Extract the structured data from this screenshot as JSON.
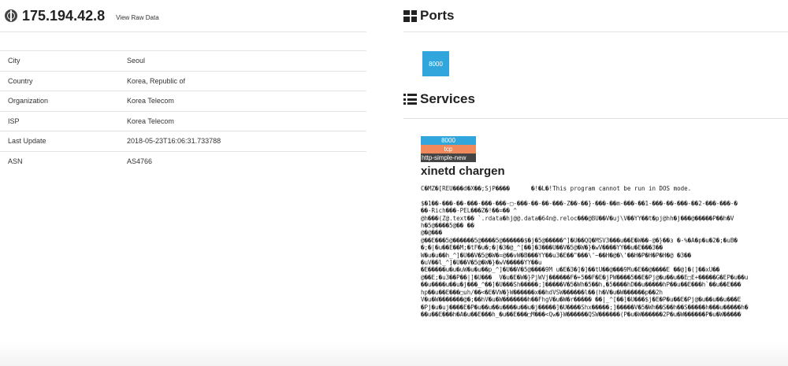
{
  "host": {
    "ip": "175.194.42.8",
    "raw_link": "View Raw Data"
  },
  "info": [
    {
      "key": "City",
      "value": "Seoul"
    },
    {
      "key": "Country",
      "value": "Korea, Republic of"
    },
    {
      "key": "Organization",
      "value": "Korea Telecom"
    },
    {
      "key": "ISP",
      "value": "Korea Telecom"
    },
    {
      "key": "Last Update",
      "value": "2018-05-23T16:06:31.733788"
    },
    {
      "key": "ASN",
      "value": "AS4766"
    }
  ],
  "ports": {
    "title": "Ports",
    "items": [
      "8000"
    ]
  },
  "services": {
    "title": "Services",
    "port": "8000",
    "protocol": "tcp",
    "module": "http-simple-new",
    "product": "xinetd chargen",
    "banner_lines": [
      "C�MZ�[REU���d�X��;SjP����      �!�L�!This program cannot be run in DOS mode.",
      "",
      "$�1��-���-��-���-���-���-□-���-��-��-���-Z��-��}-���-��m-���-��1-���-��-���-��2-���-���-�",
      "��-Rich���-PEL���Z�!��=�� ^",
      "@h���(Z@.text�� `.rdata�hj@@.data�64n@.reloc���@BU��V�uj\\V��YY��t�pj@hh�j���@�����P��h�V",
      "h�5@����5@�� ��",
      "@�@���",
      "@��E���5@������5@����5@������$�j�5@�����^]�U��QQ�MSV3���u��E�W��-@�}��з �-%�A�p�u�2�;�uB�",
      "�;�|�u��E��M;�tF�u�;�|�3�@_^[��]�3���U��V�5@�W�}�wV����YY��u�E���3��",
      "W�u�u��h_^]�U��V�5@�W�=@��vW�B���YY��u3�E��\"���\\'~��H�@�\\'��H�P�H�P�H�@ �3��",
      "�uV��l_^]�U��V�5@�W�}�wV�����YY��u",
      "�E�����u�u�uW�u�u��p_^]�U��V�5@����9M u�E�3�]�]��tU��@���9Mu�E��@����E ��@]�(]��xU��",
      "@��E;�u3��P��|]�U���  V�u�E�W�}PjWVj������F�+5��F�E�jPW����5��E�Pj@�u��u��E□E+�����G�EP�u��u",
      "��u����u��u�j���_^��]�U���Sh�����;]�����V�5�Wh�5��h,�5����hD��u�����hP��u��E���h`��u��E���",
      "hp��u��E���□uh/��<�E�VW�}W������x��hdVSW������l��(h�V�u�W������p��2h",
      "V�u�W�������@�;��hV�u�W�������h��FhgV�u�W�r����� ��|_^[��]�U���$j�E�P�u��E�Pj@�u��u��u���E",
      "�Pj�u�uj����E�P�u��u��u����u��u�j�����]�U����Shx�����;]�����V�5�Wh��S��h��S�����h���u�����h�",
      "��u��E���h�A�u��E���h_�u��E���□M���<Qw�}W������QSW������(P�u�W������2P�u�W������P�u�W�����"
    ]
  }
}
